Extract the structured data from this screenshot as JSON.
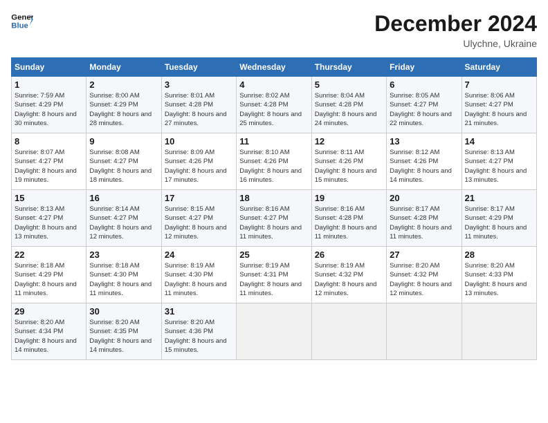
{
  "logo": {
    "line1": "General",
    "line2": "Blue"
  },
  "title": "December 2024",
  "subtitle": "Ulychne, Ukraine",
  "days_header": [
    "Sunday",
    "Monday",
    "Tuesday",
    "Wednesday",
    "Thursday",
    "Friday",
    "Saturday"
  ],
  "weeks": [
    [
      {
        "day": "1",
        "sunrise": "Sunrise: 7:59 AM",
        "sunset": "Sunset: 4:29 PM",
        "daylight": "Daylight: 8 hours and 30 minutes."
      },
      {
        "day": "2",
        "sunrise": "Sunrise: 8:00 AM",
        "sunset": "Sunset: 4:29 PM",
        "daylight": "Daylight: 8 hours and 28 minutes."
      },
      {
        "day": "3",
        "sunrise": "Sunrise: 8:01 AM",
        "sunset": "Sunset: 4:28 PM",
        "daylight": "Daylight: 8 hours and 27 minutes."
      },
      {
        "day": "4",
        "sunrise": "Sunrise: 8:02 AM",
        "sunset": "Sunset: 4:28 PM",
        "daylight": "Daylight: 8 hours and 25 minutes."
      },
      {
        "day": "5",
        "sunrise": "Sunrise: 8:04 AM",
        "sunset": "Sunset: 4:28 PM",
        "daylight": "Daylight: 8 hours and 24 minutes."
      },
      {
        "day": "6",
        "sunrise": "Sunrise: 8:05 AM",
        "sunset": "Sunset: 4:27 PM",
        "daylight": "Daylight: 8 hours and 22 minutes."
      },
      {
        "day": "7",
        "sunrise": "Sunrise: 8:06 AM",
        "sunset": "Sunset: 4:27 PM",
        "daylight": "Daylight: 8 hours and 21 minutes."
      }
    ],
    [
      {
        "day": "8",
        "sunrise": "Sunrise: 8:07 AM",
        "sunset": "Sunset: 4:27 PM",
        "daylight": "Daylight: 8 hours and 19 minutes."
      },
      {
        "day": "9",
        "sunrise": "Sunrise: 8:08 AM",
        "sunset": "Sunset: 4:27 PM",
        "daylight": "Daylight: 8 hours and 18 minutes."
      },
      {
        "day": "10",
        "sunrise": "Sunrise: 8:09 AM",
        "sunset": "Sunset: 4:26 PM",
        "daylight": "Daylight: 8 hours and 17 minutes."
      },
      {
        "day": "11",
        "sunrise": "Sunrise: 8:10 AM",
        "sunset": "Sunset: 4:26 PM",
        "daylight": "Daylight: 8 hours and 16 minutes."
      },
      {
        "day": "12",
        "sunrise": "Sunrise: 8:11 AM",
        "sunset": "Sunset: 4:26 PM",
        "daylight": "Daylight: 8 hours and 15 minutes."
      },
      {
        "day": "13",
        "sunrise": "Sunrise: 8:12 AM",
        "sunset": "Sunset: 4:26 PM",
        "daylight": "Daylight: 8 hours and 14 minutes."
      },
      {
        "day": "14",
        "sunrise": "Sunrise: 8:13 AM",
        "sunset": "Sunset: 4:27 PM",
        "daylight": "Daylight: 8 hours and 13 minutes."
      }
    ],
    [
      {
        "day": "15",
        "sunrise": "Sunrise: 8:13 AM",
        "sunset": "Sunset: 4:27 PM",
        "daylight": "Daylight: 8 hours and 13 minutes."
      },
      {
        "day": "16",
        "sunrise": "Sunrise: 8:14 AM",
        "sunset": "Sunset: 4:27 PM",
        "daylight": "Daylight: 8 hours and 12 minutes."
      },
      {
        "day": "17",
        "sunrise": "Sunrise: 8:15 AM",
        "sunset": "Sunset: 4:27 PM",
        "daylight": "Daylight: 8 hours and 12 minutes."
      },
      {
        "day": "18",
        "sunrise": "Sunrise: 8:16 AM",
        "sunset": "Sunset: 4:27 PM",
        "daylight": "Daylight: 8 hours and 11 minutes."
      },
      {
        "day": "19",
        "sunrise": "Sunrise: 8:16 AM",
        "sunset": "Sunset: 4:28 PM",
        "daylight": "Daylight: 8 hours and 11 minutes."
      },
      {
        "day": "20",
        "sunrise": "Sunrise: 8:17 AM",
        "sunset": "Sunset: 4:28 PM",
        "daylight": "Daylight: 8 hours and 11 minutes."
      },
      {
        "day": "21",
        "sunrise": "Sunrise: 8:17 AM",
        "sunset": "Sunset: 4:29 PM",
        "daylight": "Daylight: 8 hours and 11 minutes."
      }
    ],
    [
      {
        "day": "22",
        "sunrise": "Sunrise: 8:18 AM",
        "sunset": "Sunset: 4:29 PM",
        "daylight": "Daylight: 8 hours and 11 minutes."
      },
      {
        "day": "23",
        "sunrise": "Sunrise: 8:18 AM",
        "sunset": "Sunset: 4:30 PM",
        "daylight": "Daylight: 8 hours and 11 minutes."
      },
      {
        "day": "24",
        "sunrise": "Sunrise: 8:19 AM",
        "sunset": "Sunset: 4:30 PM",
        "daylight": "Daylight: 8 hours and 11 minutes."
      },
      {
        "day": "25",
        "sunrise": "Sunrise: 8:19 AM",
        "sunset": "Sunset: 4:31 PM",
        "daylight": "Daylight: 8 hours and 11 minutes."
      },
      {
        "day": "26",
        "sunrise": "Sunrise: 8:19 AM",
        "sunset": "Sunset: 4:32 PM",
        "daylight": "Daylight: 8 hours and 12 minutes."
      },
      {
        "day": "27",
        "sunrise": "Sunrise: 8:20 AM",
        "sunset": "Sunset: 4:32 PM",
        "daylight": "Daylight: 8 hours and 12 minutes."
      },
      {
        "day": "28",
        "sunrise": "Sunrise: 8:20 AM",
        "sunset": "Sunset: 4:33 PM",
        "daylight": "Daylight: 8 hours and 13 minutes."
      }
    ],
    [
      {
        "day": "29",
        "sunrise": "Sunrise: 8:20 AM",
        "sunset": "Sunset: 4:34 PM",
        "daylight": "Daylight: 8 hours and 14 minutes."
      },
      {
        "day": "30",
        "sunrise": "Sunrise: 8:20 AM",
        "sunset": "Sunset: 4:35 PM",
        "daylight": "Daylight: 8 hours and 14 minutes."
      },
      {
        "day": "31",
        "sunrise": "Sunrise: 8:20 AM",
        "sunset": "Sunset: 4:36 PM",
        "daylight": "Daylight: 8 hours and 15 minutes."
      },
      null,
      null,
      null,
      null
    ]
  ]
}
